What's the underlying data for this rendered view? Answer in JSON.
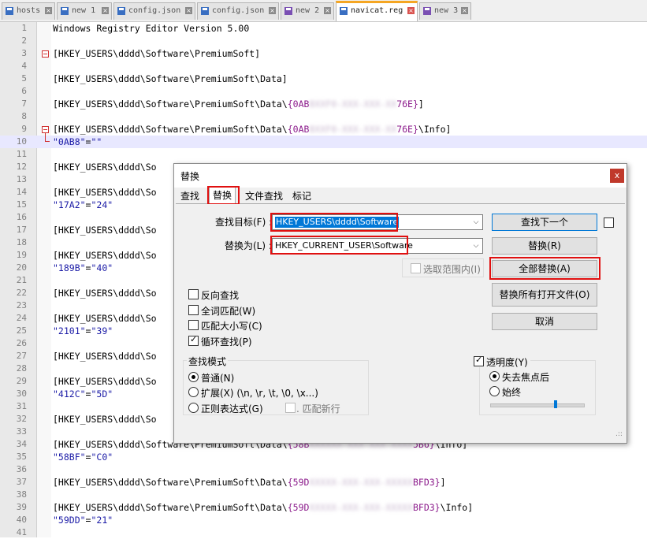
{
  "tabs": [
    {
      "label": "hosts",
      "active": false
    },
    {
      "label": "new 1",
      "active": false
    },
    {
      "label": "config.json",
      "active": false
    },
    {
      "label": "config.json",
      "active": false
    },
    {
      "label": "new 2",
      "active": false
    },
    {
      "label": "navicat.reg",
      "active": true
    },
    {
      "label": "new 3",
      "active": false
    }
  ],
  "editor": {
    "lines": [
      {
        "n": "1",
        "text": "Windows Registry Editor Version 5.00"
      },
      {
        "n": "2",
        "text": ""
      },
      {
        "n": "3",
        "text": "[HKEY_USERS\\dddd\\Software\\PremiumSoft]"
      },
      {
        "n": "4",
        "text": ""
      },
      {
        "n": "5",
        "text": "[HKEY_USERS\\dddd\\Software\\PremiumSoft\\Data]"
      },
      {
        "n": "6",
        "text": ""
      },
      {
        "n": "7",
        "pre": "[HKEY_USERS\\dddd\\Software\\PremiumSoft\\Data\\",
        "g1": "{0AB",
        "blur": "8XXF0-XXX-XXX-XX",
        "g2": "76E}",
        "post": "]"
      },
      {
        "n": "8",
        "text": ""
      },
      {
        "n": "9",
        "pre": "[HKEY_USERS\\dddd\\Software\\PremiumSoft\\Data\\",
        "g1": "{0AB",
        "blur": "8XXF0-XXX-XXX-XX",
        "g2": "76E}",
        "post": "\\Info]"
      },
      {
        "n": "10",
        "k": "\"0AB8\"",
        "v": "\"\""
      },
      {
        "n": "11",
        "text": ""
      },
      {
        "n": "12",
        "text": "[HKEY_USERS\\dddd\\So"
      },
      {
        "n": "13",
        "text": ""
      },
      {
        "n": "14",
        "text": "[HKEY_USERS\\dddd\\So"
      },
      {
        "n": "15",
        "k": "\"17A2\"",
        "v": "\"24\""
      },
      {
        "n": "16",
        "text": ""
      },
      {
        "n": "17",
        "text": "[HKEY_USERS\\dddd\\So"
      },
      {
        "n": "18",
        "text": ""
      },
      {
        "n": "19",
        "text": "[HKEY_USERS\\dddd\\So"
      },
      {
        "n": "20",
        "k": "\"189B\"",
        "v": "\"40\""
      },
      {
        "n": "21",
        "text": ""
      },
      {
        "n": "22",
        "text": "[HKEY_USERS\\dddd\\So"
      },
      {
        "n": "23",
        "text": ""
      },
      {
        "n": "24",
        "text": "[HKEY_USERS\\dddd\\So"
      },
      {
        "n": "25",
        "k": "\"2101\"",
        "v": "\"39\""
      },
      {
        "n": "26",
        "text": ""
      },
      {
        "n": "27",
        "text": "[HKEY_USERS\\dddd\\So"
      },
      {
        "n": "28",
        "text": ""
      },
      {
        "n": "29",
        "text": "[HKEY_USERS\\dddd\\So"
      },
      {
        "n": "30",
        "k": "\"412C\"",
        "v": "\"5D\""
      },
      {
        "n": "31",
        "text": ""
      },
      {
        "n": "32",
        "text": "[HKEY_USERS\\dddd\\So"
      },
      {
        "n": "33",
        "text": ""
      },
      {
        "n": "34",
        "pre": "[HKEY_USERS\\dddd\\Software\\PremiumSoft\\Data\\",
        "g1": "{58B",
        "blur": "XXXXXX-XXX-XXX-XXXX",
        "g2": "5B6}",
        "post": "\\Info]"
      },
      {
        "n": "35",
        "k": "\"58BF\"",
        "v": "\"C0\""
      },
      {
        "n": "36",
        "text": ""
      },
      {
        "n": "37",
        "pre": "[HKEY_USERS\\dddd\\Software\\PremiumSoft\\Data\\",
        "g1": "{59D",
        "blur": "XXXXX-XXX-XXX-XXXXX",
        "g2": "BFD3}",
        "post": "]"
      },
      {
        "n": "38",
        "text": ""
      },
      {
        "n": "39",
        "pre": "[HKEY_USERS\\dddd\\Software\\PremiumSoft\\Data\\",
        "g1": "{59D",
        "blur": "XXXXX-XXX-XXX-XXXXX",
        "g2": "BFD3}",
        "post": "\\Info]"
      },
      {
        "n": "40",
        "k": "\"59DD\"",
        "v": "\"21\""
      },
      {
        "n": "41",
        "text": ""
      }
    ]
  },
  "dialog": {
    "title": "替换",
    "close": "x",
    "tabs": [
      "查找",
      "替换",
      "文件查找",
      "标记"
    ],
    "find_label": "查找目标(F) :",
    "find_value": "HKEY_USERS\\dddd\\Software",
    "replace_label": "替换为(L) :",
    "replace_value": "HKEY_CURRENT_USER\\Software",
    "in_selection": "选取范围内(I)",
    "buttons": {
      "find_next": "查找下一个",
      "replace": "替换(R)",
      "replace_all": "全部替换(A)",
      "replace_all_open": "替换所有打开文件(O)",
      "cancel": "取消"
    },
    "options": [
      {
        "label": "反向查找",
        "checked": false
      },
      {
        "label": "全词匹配(W)",
        "checked": false
      },
      {
        "label": "匹配大小写(C)",
        "checked": false
      },
      {
        "label": "循环查找(P)",
        "checked": true
      }
    ],
    "search_mode": {
      "title": "查找模式",
      "normal": "普通(N)",
      "extended": "扩展(X) (\\n, \\r, \\t, \\0, \\x...)",
      "regex": "正则表达式(G)",
      "dot_newline": ". 匹配新行",
      "selected": "normal"
    },
    "transparency": {
      "title": "透明度(Y)",
      "checked": true,
      "on_lose_focus": "失去焦点后",
      "always": "始终",
      "selected": "on_lose_focus",
      "slider_level": 0.7
    },
    "grip": ".::"
  },
  "colors": {
    "active_tab_accent": "#f5a623",
    "highlight_box": "#e01010",
    "selection": "#0078d7"
  }
}
